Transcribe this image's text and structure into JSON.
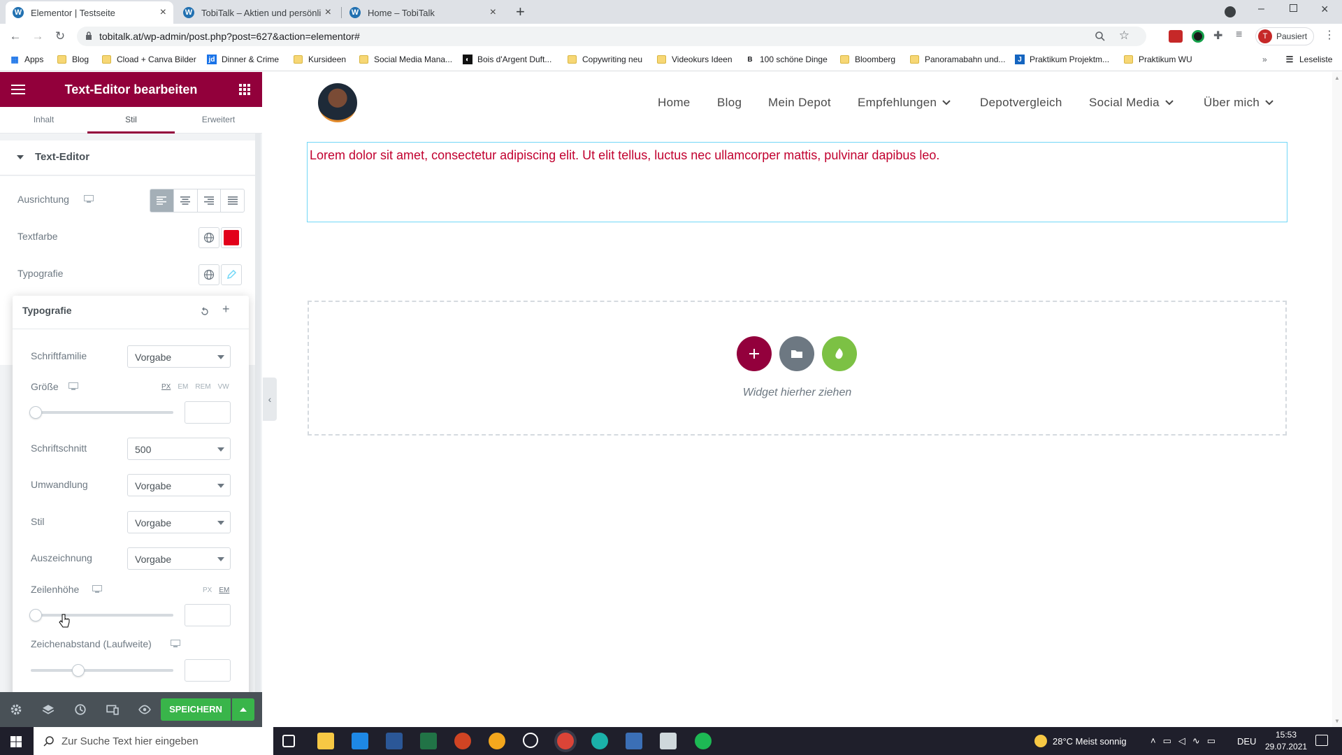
{
  "browser": {
    "tabs": [
      {
        "title": "Elementor | Testseite",
        "active": true
      },
      {
        "title": "TobiTalk – Aktien und persönlich",
        "active": false
      },
      {
        "title": "Home – TobiTalk",
        "active": false
      }
    ],
    "url": "tobitalk.at/wp-admin/post.php?post=627&action=elementor#",
    "profile_initial": "T",
    "profile_label": "Pausiert",
    "bookmarks": [
      "Apps",
      "Blog",
      "Cload + Canva Bilder",
      "Dinner & Crime",
      "Kursideen",
      "Social Media Mana...",
      "Bois d'Argent Duft...",
      "Copywriting neu",
      "Videokurs Ideen",
      "100 schöne Dinge",
      "Bloomberg",
      "Panoramabahn und...",
      "Praktikum Projektm...",
      "Praktikum WU"
    ],
    "reading_list": "Leseliste"
  },
  "panel": {
    "title": "Text-Editor bearbeiten",
    "tabs": [
      "Inhalt",
      "Stil",
      "Erweitert"
    ],
    "active_tab": "Stil",
    "section": "Text-Editor",
    "alignment_label": "Ausrichtung",
    "textcolor_label": "Textfarbe",
    "textcolor_value": "#e2001a",
    "typography_label": "Typografie",
    "popover": {
      "title": "Typografie",
      "font_family": {
        "label": "Schriftfamilie",
        "value": "Vorgabe"
      },
      "size": {
        "label": "Größe",
        "units": [
          "PX",
          "EM",
          "REM",
          "VW"
        ],
        "active_unit": "PX",
        "value": "",
        "slider_position": 0
      },
      "weight": {
        "label": "Schriftschnitt",
        "value": "500"
      },
      "transform": {
        "label": "Umwandlung",
        "value": "Vorgabe"
      },
      "style": {
        "label": "Stil",
        "value": "Vorgabe"
      },
      "decoration": {
        "label": "Auszeichnung",
        "value": "Vorgabe"
      },
      "line_height": {
        "label": "Zeilenhöhe",
        "units": [
          "PX",
          "EM"
        ],
        "active_unit": "EM",
        "value": "",
        "slider_position": 0
      },
      "letter_spacing": {
        "label": "Zeichenabstand (Laufweite)",
        "value": "",
        "slider_position": 0.33
      }
    },
    "save_label": "SPEICHERN"
  },
  "site": {
    "nav": [
      {
        "label": "Home",
        "dropdown": false
      },
      {
        "label": "Blog",
        "dropdown": false
      },
      {
        "label": "Mein Depot",
        "dropdown": false
      },
      {
        "label": "Empfehlungen",
        "dropdown": true
      },
      {
        "label": "Depotvergleich",
        "dropdown": false
      },
      {
        "label": "Social Media",
        "dropdown": true
      },
      {
        "label": "Über mich",
        "dropdown": true
      }
    ],
    "text": "Lorem dolor sit amet, consectetur adipiscing elit. Ut elit tellus, luctus nec ullamcorper mattis, pulvinar dapibus leo.",
    "drop_hint": "Widget hierher ziehen",
    "accent": "#93003c",
    "text_color": "#c1002f"
  },
  "taskbar": {
    "search_placeholder": "Zur Suche Text hier eingeben",
    "weather": "28°C  Meist sonnig",
    "language": "DEU",
    "time": "15:53",
    "date": "29.07.2021"
  }
}
